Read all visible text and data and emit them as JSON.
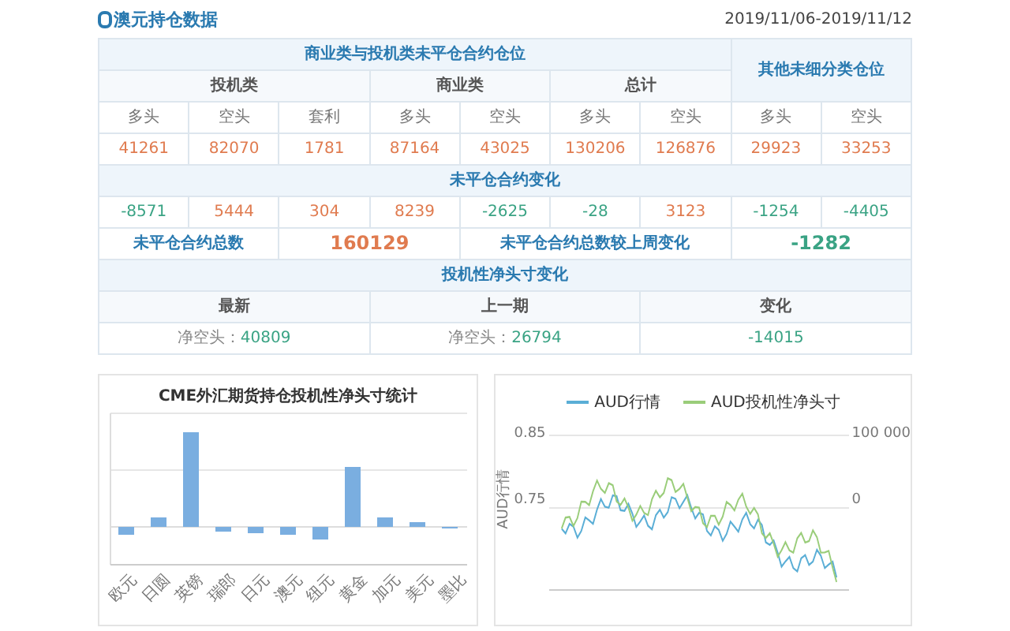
{
  "title": "澳元持仓数据",
  "date_range": "2019/11/06-2019/11/12",
  "table": {
    "group_header": "商业类与投机类未平仓合约仓位",
    "other_header": "其他未细分类仓位",
    "categories": [
      "投机类",
      "商业类",
      "总计"
    ],
    "sub_headers": [
      "多头",
      "空头",
      "套利",
      "多头",
      "空头",
      "多头",
      "空头",
      "多头",
      "空头"
    ],
    "positions": [
      {
        "text": "41261",
        "color": "#e07b4f"
      },
      {
        "text": "82070",
        "color": "#e07b4f"
      },
      {
        "text": "1781",
        "color": "#e07b4f"
      },
      {
        "text": "87164",
        "color": "#e07b4f"
      },
      {
        "text": "43025",
        "color": "#e07b4f"
      },
      {
        "text": "130206",
        "color": "#e07b4f"
      },
      {
        "text": "126876",
        "color": "#e07b4f"
      },
      {
        "text": "29923",
        "color": "#e07b4f"
      },
      {
        "text": "33253",
        "color": "#e07b4f"
      }
    ],
    "change_header": "未平仓合约变化",
    "changes": [
      {
        "text": "-8571",
        "color": "#3aa384"
      },
      {
        "text": "5444",
        "color": "#e07b4f"
      },
      {
        "text": "304",
        "color": "#e07b4f"
      },
      {
        "text": "8239",
        "color": "#e07b4f"
      },
      {
        "text": "-2625",
        "color": "#3aa384"
      },
      {
        "text": "-28",
        "color": "#3aa384"
      },
      {
        "text": "3123",
        "color": "#e07b4f"
      },
      {
        "text": "-1254",
        "color": "#3aa384"
      },
      {
        "text": "-4405",
        "color": "#3aa384"
      }
    ],
    "total_label": "未平仓合约总数",
    "total_value": {
      "text": "160129",
      "color": "#e07b4f"
    },
    "weekly_change_label": "未平仓合约总数较上周变化",
    "weekly_change_value": {
      "text": "-1282",
      "color": "#3aa384"
    },
    "net_header": "投机性净头寸变化",
    "net_columns": [
      "最新",
      "上一期",
      "变化"
    ],
    "net_values": [
      {
        "label": "净空头：",
        "value": "40809",
        "color": "#3aa384"
      },
      {
        "label": "净空头：",
        "value": "26794",
        "color": "#3aa384"
      },
      {
        "value": "-14015",
        "color": "#3aa384"
      }
    ]
  },
  "bar_chart": {
    "title": "CME外汇期货持仓投机性净头寸统计",
    "categories": [
      "欧元",
      "日圆",
      "英镑",
      "瑞郎",
      "日元",
      "澳元",
      "纽元",
      "黄金",
      "加元",
      "美元",
      "墨比"
    ]
  },
  "line_chart": {
    "legend": [
      {
        "name": "AUD行情",
        "color": "#5aaed6"
      },
      {
        "name": "AUD投机性净头寸",
        "color": "#9acd7a"
      }
    ],
    "ylabel": "AUD行情",
    "left_ticks": [
      "0.85",
      "0.75"
    ],
    "right_ticks": [
      "100 000",
      "0"
    ]
  }
}
